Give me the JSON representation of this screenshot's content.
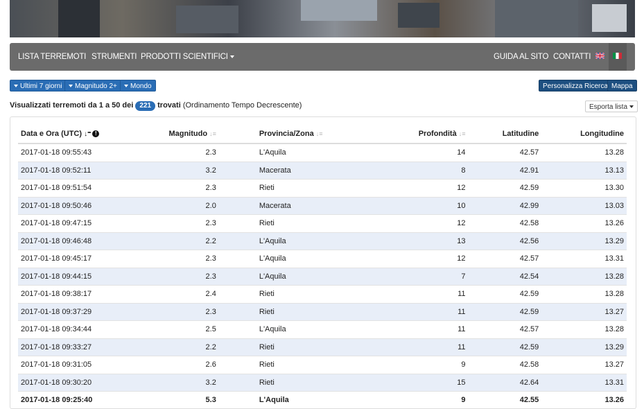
{
  "nav": {
    "items": [
      "LISTA TERREMOTI",
      "STRUMENTI",
      "PRODOTTI SCIENTIFICI"
    ],
    "right_items": [
      "GUIDA AL SITO",
      "CONTATTI"
    ]
  },
  "filters": {
    "period": "Ultimi 7 giorni",
    "magnitude": "Magnitudo 2+",
    "area": "Mondo"
  },
  "actions": {
    "customize": "Personalizza Ricerca",
    "map": "Mappa",
    "export": "Esporta lista"
  },
  "summary": {
    "prefix": "Visualizzati terremoti da 1 a 50 dei",
    "count": "221",
    "found": "trovati",
    "order": "(Ordinamento Tempo Decrescente)"
  },
  "table": {
    "headers": [
      "Data e Ora (UTC)",
      "Magnitudo",
      "Provincia/Zona",
      "Profondità",
      "Latitudine",
      "Longitudine"
    ],
    "rows": [
      [
        "2017-01-18 09:55:43",
        "2.3",
        "L'Aquila",
        "14",
        "42.57",
        "13.28"
      ],
      [
        "2017-01-18 09:52:11",
        "3.2",
        "Macerata",
        "8",
        "42.91",
        "13.13"
      ],
      [
        "2017-01-18 09:51:54",
        "2.3",
        "Rieti",
        "12",
        "42.59",
        "13.30"
      ],
      [
        "2017-01-18 09:50:46",
        "2.0",
        "Macerata",
        "10",
        "42.99",
        "13.03"
      ],
      [
        "2017-01-18 09:47:15",
        "2.3",
        "Rieti",
        "12",
        "42.58",
        "13.26"
      ],
      [
        "2017-01-18 09:46:48",
        "2.2",
        "L'Aquila",
        "13",
        "42.56",
        "13.29"
      ],
      [
        "2017-01-18 09:45:17",
        "2.3",
        "L'Aquila",
        "12",
        "42.57",
        "13.31"
      ],
      [
        "2017-01-18 09:44:15",
        "2.3",
        "L'Aquila",
        "7",
        "42.54",
        "13.28"
      ],
      [
        "2017-01-18 09:38:17",
        "2.4",
        "Rieti",
        "11",
        "42.59",
        "13.28"
      ],
      [
        "2017-01-18 09:37:29",
        "2.3",
        "Rieti",
        "11",
        "42.59",
        "13.27"
      ],
      [
        "2017-01-18 09:34:44",
        "2.5",
        "L'Aquila",
        "11",
        "42.57",
        "13.28"
      ],
      [
        "2017-01-18 09:33:27",
        "2.2",
        "Rieti",
        "11",
        "42.59",
        "13.29"
      ],
      [
        "2017-01-18 09:31:05",
        "2.6",
        "Rieti",
        "9",
        "42.58",
        "13.27"
      ],
      [
        "2017-01-18 09:30:20",
        "3.2",
        "Rieti",
        "15",
        "42.64",
        "13.31"
      ],
      [
        "2017-01-18 09:25:40",
        "5.3",
        "L'Aquila",
        "9",
        "42.55",
        "13.26"
      ]
    ]
  }
}
